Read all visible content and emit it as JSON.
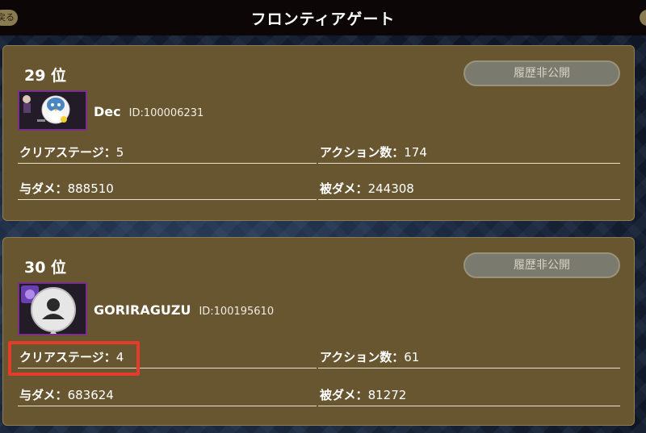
{
  "header": {
    "title": "フロンティアゲート",
    "back_label": "戻る"
  },
  "entries": [
    {
      "rank": "29 位",
      "private_label": "履歴非公開",
      "name": "Dec",
      "id": "ID:100006231",
      "stats": [
        {
          "label": "クリアステージ：",
          "value": "5"
        },
        {
          "label": "アクション数：",
          "value": "174"
        },
        {
          "label": "与ダメ：",
          "value": "888510"
        },
        {
          "label": "被ダメ：",
          "value": "244308"
        }
      ]
    },
    {
      "rank": "30 位",
      "private_label": "履歴非公開",
      "name": "GORIRAGUZU",
      "id": "ID:100195610",
      "stats": [
        {
          "label": "クリアステージ：",
          "value": "4"
        },
        {
          "label": "アクション数：",
          "value": "61"
        },
        {
          "label": "与ダメ：",
          "value": "683624"
        },
        {
          "label": "被ダメ：",
          "value": "81272"
        }
      ]
    }
  ],
  "colors": {
    "card": "#685631",
    "highlight": "#e53b2a",
    "avatar_frame": "#7a2f8a"
  }
}
